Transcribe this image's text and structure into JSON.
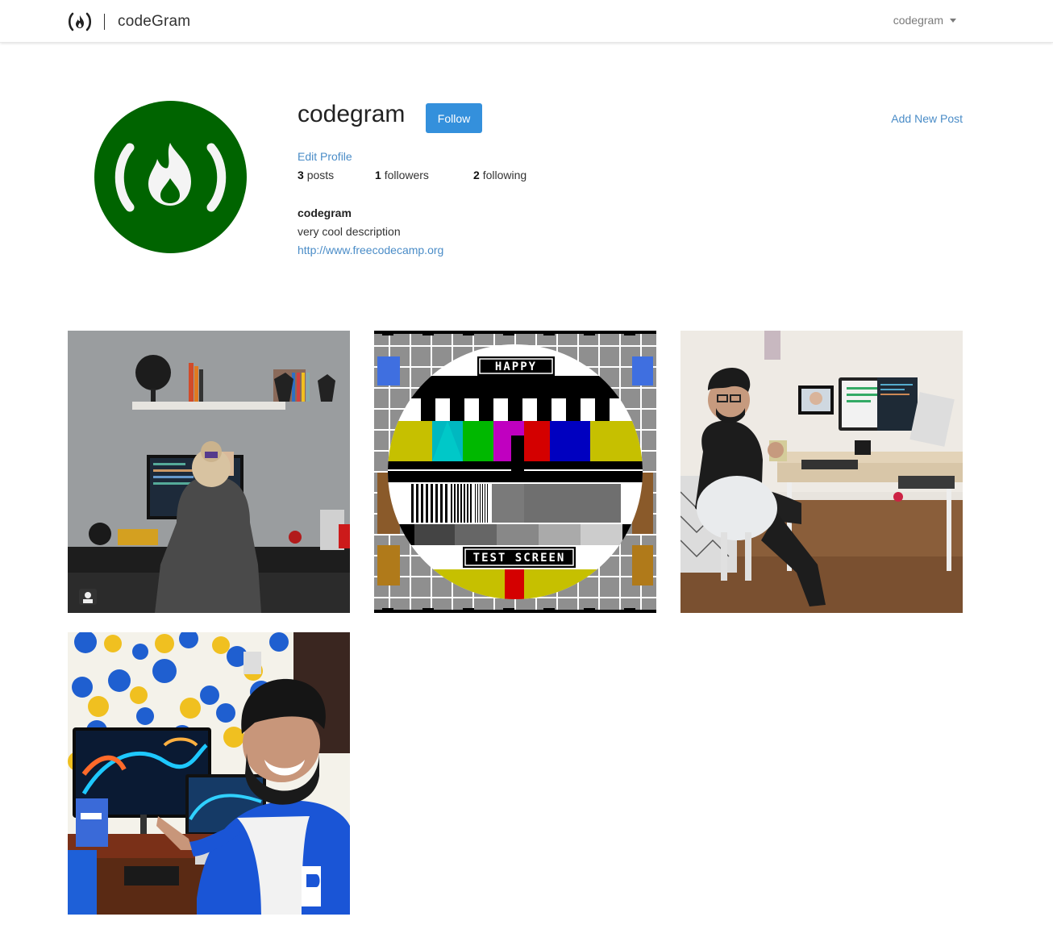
{
  "navbar": {
    "brand_name": "codeGram",
    "user_menu_label": "codegram"
  },
  "profile": {
    "username": "codegram",
    "follow_label": "Follow",
    "add_post_label": "Add New Post",
    "edit_profile_label": "Edit Profile",
    "stats": {
      "posts_count": "3",
      "posts_label": "posts",
      "followers_count": "1",
      "followers_label": "followers",
      "following_count": "2",
      "following_label": "following"
    },
    "bio": {
      "title": "codegram",
      "description": "very cool description",
      "url": "http://www.freecodecamp.org"
    },
    "avatar_color": "#006400"
  },
  "posts": [
    {
      "id": "post-1",
      "subject": "woman at standing desk"
    },
    {
      "id": "post-2",
      "subject": "test screen pattern",
      "banner_top": "HAPPY",
      "banner_bottom": "TEST SCREEN"
    },
    {
      "id": "post-3",
      "subject": "man at desk setup"
    },
    {
      "id": "post-4",
      "subject": "man pointing at monitor"
    }
  ],
  "colors": {
    "link": "#4a8cc7",
    "button": "#3490dc"
  }
}
